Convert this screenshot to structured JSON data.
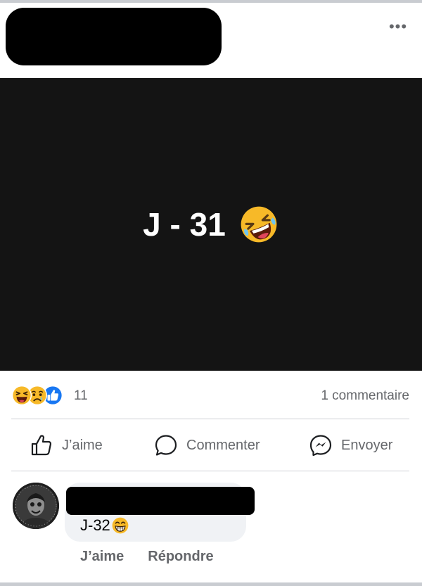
{
  "post": {
    "header": {
      "more_icon": "more-horizontal-icon",
      "more_label": "•••"
    },
    "media": {
      "text": "J - 31",
      "emoji": "rolling-on-floor-laughing-emoji",
      "background": "#141414"
    },
    "stats": {
      "reaction_icons": [
        "haha-reaction-icon",
        "sad-reaction-icon",
        "like-reaction-icon"
      ],
      "reaction_count": "11",
      "comment_count": "1 commentaire"
    },
    "actions": {
      "like_label": "J’aime",
      "comment_label": "Commenter",
      "send_label": "Envoyer"
    }
  },
  "comment": {
    "text": "J-32",
    "emoji": "grinning-face-emoji",
    "like_label": "J’aime",
    "reply_label": "Répondre"
  },
  "colors": {
    "meta_text": "#65676b",
    "divider": "#ced0d4",
    "bubble": "#f0f2f5",
    "like_blue": "#1877f2",
    "emoji_yellow": "#f7b928"
  }
}
